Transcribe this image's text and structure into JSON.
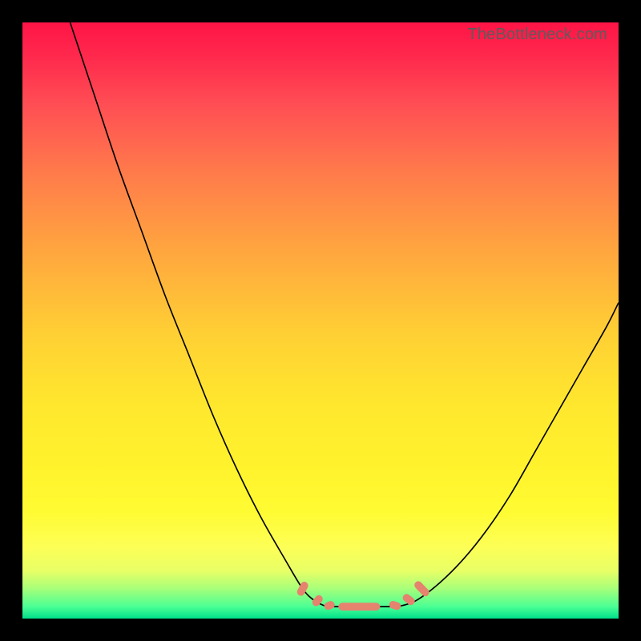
{
  "watermark": "TheBottleneck.com",
  "chart_data": {
    "type": "line",
    "title": "",
    "xlabel": "",
    "ylabel": "",
    "xlim": [
      0,
      100
    ],
    "ylim": [
      0,
      100
    ],
    "series": [
      {
        "name": "left-curve",
        "x": [
          8,
          12,
          16,
          20,
          24,
          28,
          32,
          36,
          40,
          44,
          47,
          49,
          51
        ],
        "y": [
          100,
          88,
          76,
          65,
          54,
          44,
          34,
          25,
          17,
          10,
          5,
          3,
          2
        ]
      },
      {
        "name": "floor",
        "x": [
          51,
          54,
          57,
          60,
          63
        ],
        "y": [
          2,
          2,
          2,
          2,
          2
        ]
      },
      {
        "name": "right-curve",
        "x": [
          63,
          66,
          70,
          74,
          78,
          82,
          86,
          90,
          94,
          98,
          100
        ],
        "y": [
          2,
          3,
          6,
          10,
          15,
          21,
          28,
          35,
          42,
          49,
          53
        ]
      }
    ],
    "markers": {
      "name": "dash-markers",
      "color": "#e5836f",
      "points": [
        {
          "x": 47.0,
          "y": 5.0,
          "len": 2.5,
          "angle": -62
        },
        {
          "x": 49.5,
          "y": 3.0,
          "len": 2.0,
          "angle": -50
        },
        {
          "x": 51.5,
          "y": 2.2,
          "len": 1.8,
          "angle": -20
        },
        {
          "x": 56.5,
          "y": 2.0,
          "len": 7.0,
          "angle": 0
        },
        {
          "x": 62.5,
          "y": 2.2,
          "len": 2.0,
          "angle": 18
        },
        {
          "x": 64.8,
          "y": 3.2,
          "len": 2.2,
          "angle": 38
        },
        {
          "x": 67.0,
          "y": 5.0,
          "len": 3.0,
          "angle": 46
        }
      ]
    },
    "gradient_stops": [
      {
        "pos": 0.0,
        "color": "#ff1446"
      },
      {
        "pos": 0.5,
        "color": "#ffd633"
      },
      {
        "pos": 0.88,
        "color": "#fffb32"
      },
      {
        "pos": 1.0,
        "color": "#00e08a"
      }
    ]
  }
}
